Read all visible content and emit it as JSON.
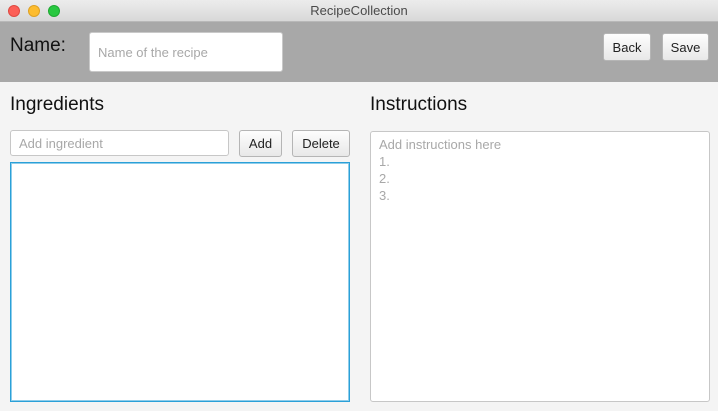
{
  "window": {
    "title": "RecipeCollection"
  },
  "header": {
    "name_label": "Name:",
    "name_placeholder": "Name of the recipe",
    "name_value": "",
    "back_label": "Back",
    "save_label": "Save"
  },
  "ingredients": {
    "title": "Ingredients",
    "input_placeholder": "Add ingredient",
    "input_value": "",
    "add_label": "Add",
    "delete_label": "Delete",
    "items": []
  },
  "instructions": {
    "title": "Instructions",
    "placeholder": "Add instructions here\n1.\n2.\n3.",
    "value": ""
  },
  "colors": {
    "header_bg": "#a8a8a8",
    "list_focus_border": "#2aa0d8"
  }
}
